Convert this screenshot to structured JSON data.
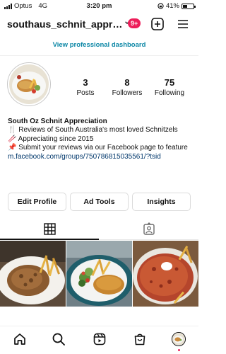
{
  "status_bar": {
    "carrier": "Optus",
    "network": "4G",
    "time": "3:20 pm",
    "battery": "41%",
    "battery_level": 0.41
  },
  "header": {
    "username": "southaus_schnit_appreci...",
    "notification_count": "9+",
    "icons": [
      "chevron-down-icon",
      "plus-square-icon",
      "menu-icon"
    ]
  },
  "dashboard_link": "View professional dashboard",
  "stats": [
    {
      "value": "3",
      "label": "Posts"
    },
    {
      "value": "8",
      "label": "Followers"
    },
    {
      "value": "75",
      "label": "Following"
    }
  ],
  "bio": {
    "name": "South Oz Schnit Appreciation",
    "line1": "🍴 Reviews of South Australia's most loved Schnitzels",
    "line2": "🥢 Appreciating since 2015",
    "line3": "📌 Submit your reviews via our Facebook page to feature",
    "link": "m.facebook.com/groups/750786815035561/?tsid"
  },
  "buttons": {
    "edit_profile": "Edit Profile",
    "ad_tools": "Ad Tools",
    "insights": "Insights"
  },
  "tabs": [
    "grid-icon",
    "tagged-person-icon"
  ],
  "posts": [
    "schnitzel-mushroom-sauce",
    "schnitzel-salad-chips",
    "schnitzel-parmigiana"
  ],
  "bottom_nav": [
    "home-icon",
    "search-icon",
    "reels-icon",
    "shop-icon",
    "profile-avatar"
  ],
  "colors": {
    "accent_link": "#0a86a5",
    "badge": "#ed1e5a",
    "bio_link": "#00376b",
    "border": "#dbdbdb"
  }
}
